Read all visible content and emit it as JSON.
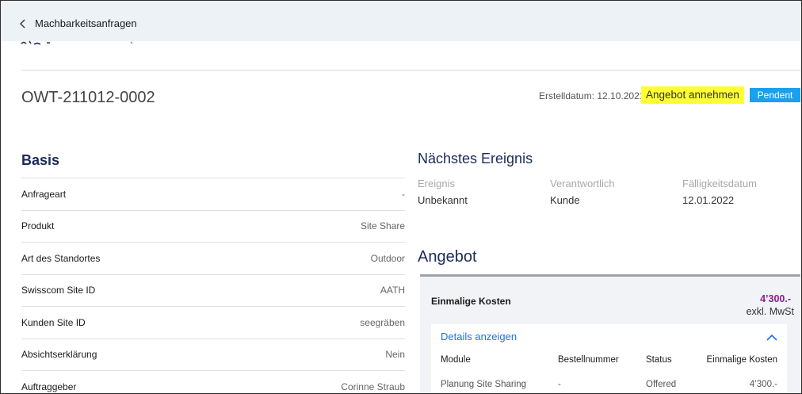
{
  "nav": {
    "back_label": "Machbarkeitsanfragen"
  },
  "header": {
    "reference": "OWT-211012-0002",
    "created_label": "Erstelldatum: ",
    "created_value": "12.10.2021",
    "accept_label": "Angebot annehmen",
    "status_badge": "Pendent",
    "colors": {
      "highlight": "#ffff33",
      "badge": "#1aa0f0"
    }
  },
  "basis": {
    "title": "Basis",
    "rows": [
      {
        "label": "Anfrageart",
        "value": "-"
      },
      {
        "label": "Produkt",
        "value": "Site Share"
      },
      {
        "label": "Art des Standortes",
        "value": "Outdoor"
      },
      {
        "label": "Swisscom Site ID",
        "value": "AATH"
      },
      {
        "label": "Kunden Site ID",
        "value": "seegräben"
      },
      {
        "label": "Absichtserklärung",
        "value": "Nein"
      },
      {
        "label": "Auftraggeber",
        "value": "Corinne Straub"
      }
    ]
  },
  "next_event": {
    "title": "Nächstes Ereignis",
    "columns": [
      {
        "header": "Ereignis",
        "value": "Unbekannt"
      },
      {
        "header": "Verantwortlich",
        "value": "Kunde"
      },
      {
        "header": "Fälligkeitsdatum",
        "value": "12.01.2022"
      }
    ]
  },
  "offer": {
    "title": "Angebot",
    "one_time_label": "Einmalige Kosten",
    "one_time_amount": "4’300.-",
    "one_time_note": "exkl. MwSt",
    "details_link": "Details anzeigen",
    "table": {
      "headers": [
        "Module",
        "Bestellnummer",
        "Status",
        "Einmalige Kosten"
      ],
      "rows": [
        [
          "Planung Site Sharing",
          "-",
          "Offered",
          "4’300.-"
        ]
      ]
    },
    "colors": {
      "amount": "#8a1f8f",
      "link": "#1a73d9"
    }
  }
}
